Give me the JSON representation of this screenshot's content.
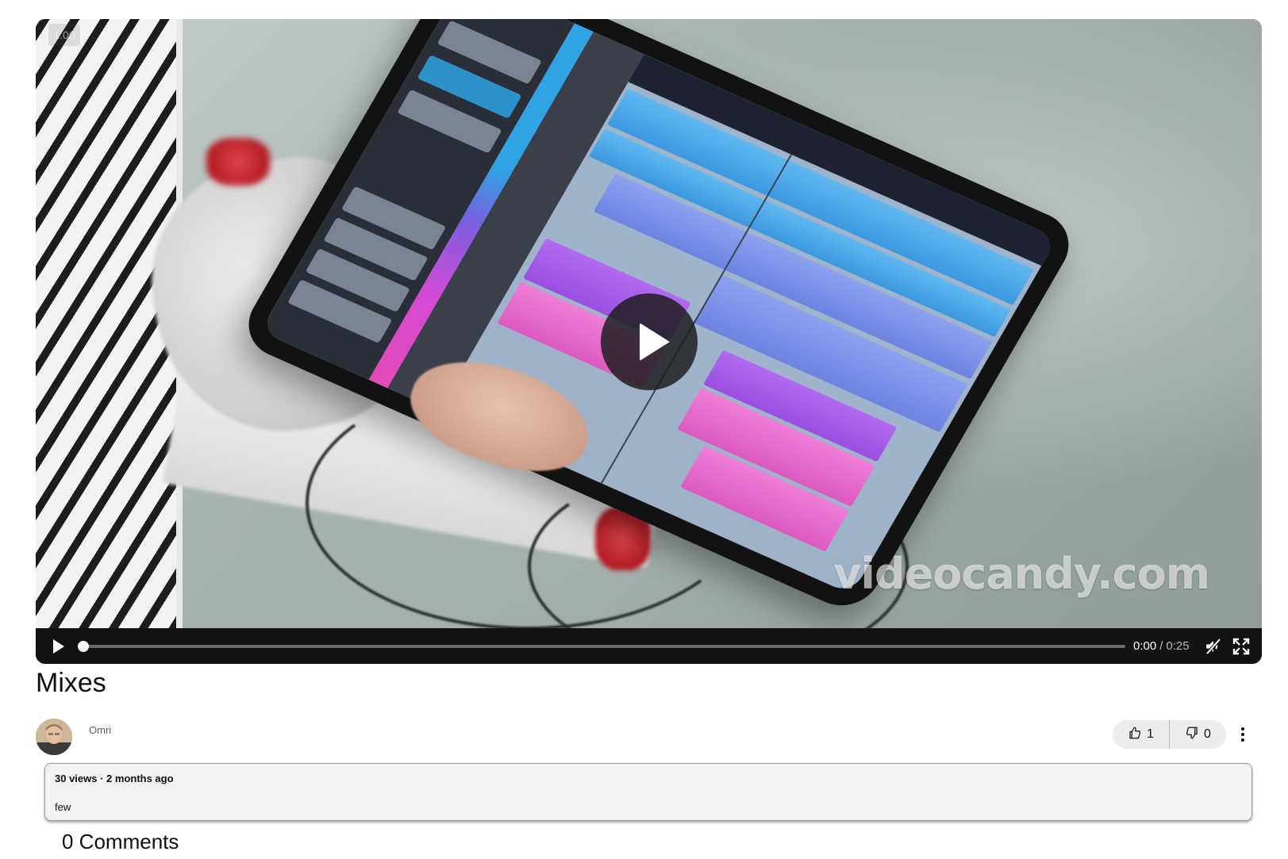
{
  "video": {
    "speed_badge": "1.00",
    "watermark": "videocandy.com",
    "current_time": "0:00",
    "separator": "/",
    "duration": "0:25",
    "progress_fraction": 0.0,
    "muted": true
  },
  "title": "Mixes",
  "channel": {
    "author_name": "Omri"
  },
  "votes": {
    "likes": "1",
    "dislikes": "0"
  },
  "description": {
    "meta": "30 views · 2 months ago",
    "text": "few"
  },
  "comments": {
    "heading": "0 Comments"
  },
  "colors": {
    "control_bar": "#121212",
    "pill_bg": "#ececec",
    "description_bg": "#f2f2f2"
  }
}
